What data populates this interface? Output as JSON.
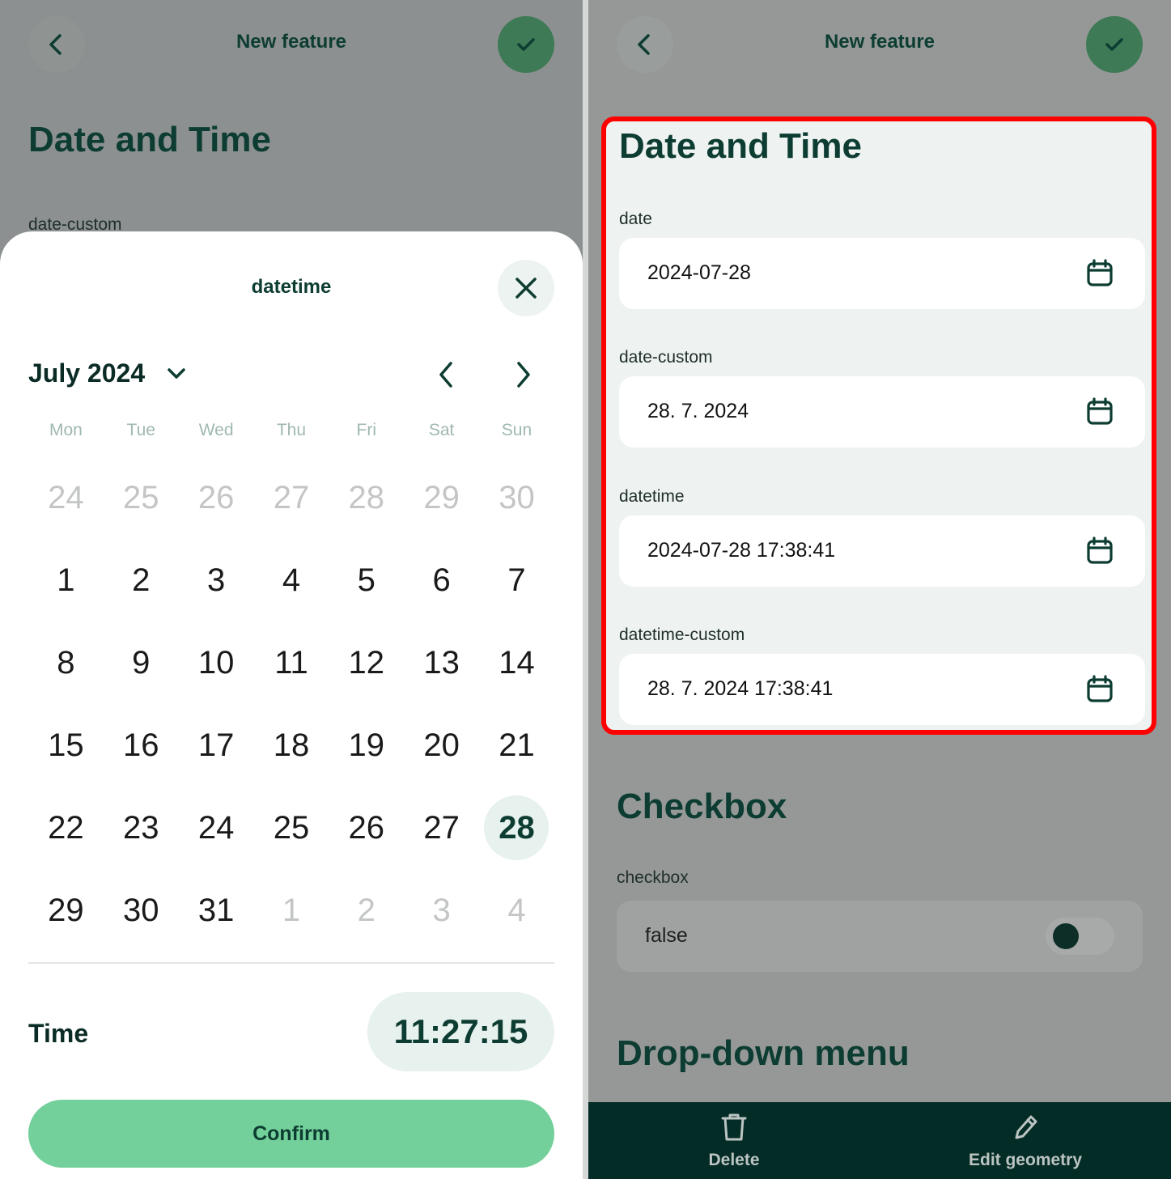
{
  "left_screen": {
    "topbar": {
      "title": "New feature"
    },
    "section_title": "Date and Time",
    "visible_field_label": "date-custom",
    "picker": {
      "title": "datetime",
      "month_label": "July 2024",
      "weekdays": [
        "Mon",
        "Tue",
        "Wed",
        "Thu",
        "Fri",
        "Sat",
        "Sun"
      ],
      "days": [
        {
          "d": "24",
          "muted": true
        },
        {
          "d": "25",
          "muted": true
        },
        {
          "d": "26",
          "muted": true
        },
        {
          "d": "27",
          "muted": true
        },
        {
          "d": "28",
          "muted": true
        },
        {
          "d": "29",
          "muted": true
        },
        {
          "d": "30",
          "muted": true
        },
        {
          "d": "1"
        },
        {
          "d": "2"
        },
        {
          "d": "3"
        },
        {
          "d": "4"
        },
        {
          "d": "5"
        },
        {
          "d": "6"
        },
        {
          "d": "7"
        },
        {
          "d": "8"
        },
        {
          "d": "9"
        },
        {
          "d": "10"
        },
        {
          "d": "11"
        },
        {
          "d": "12"
        },
        {
          "d": "13"
        },
        {
          "d": "14"
        },
        {
          "d": "15"
        },
        {
          "d": "16"
        },
        {
          "d": "17"
        },
        {
          "d": "18"
        },
        {
          "d": "19"
        },
        {
          "d": "20"
        },
        {
          "d": "21"
        },
        {
          "d": "22"
        },
        {
          "d": "23"
        },
        {
          "d": "24"
        },
        {
          "d": "25"
        },
        {
          "d": "26"
        },
        {
          "d": "27"
        },
        {
          "d": "28",
          "selected": true
        },
        {
          "d": "29"
        },
        {
          "d": "30"
        },
        {
          "d": "31"
        },
        {
          "d": "1",
          "muted": true
        },
        {
          "d": "2",
          "muted": true
        },
        {
          "d": "3",
          "muted": true
        },
        {
          "d": "4",
          "muted": true
        }
      ],
      "time_label": "Time",
      "time_value": "11:27:15",
      "confirm_label": "Confirm"
    }
  },
  "right_screen": {
    "topbar": {
      "title": "New feature"
    },
    "date_time_section": {
      "title": "Date and Time",
      "fields": [
        {
          "label": "date",
          "value": "2024-07-28"
        },
        {
          "label": "date-custom",
          "value": "28. 7. 2024"
        },
        {
          "label": "datetime",
          "value": "2024-07-28 17:38:41"
        },
        {
          "label": "datetime-custom",
          "value": "28. 7. 2024 17:38:41"
        }
      ]
    },
    "checkbox_section": {
      "title": "Checkbox",
      "label": "checkbox",
      "value": "false",
      "checked": false
    },
    "dropdown_section": {
      "title": "Drop-down menu"
    },
    "bottom_bar": {
      "delete_label": "Delete",
      "edit_geometry_label": "Edit geometry"
    }
  },
  "colors": {
    "accent_dark": "#0d3d32",
    "confirm_green": "#73d09a",
    "ok_button": "#3d7a55",
    "highlight_border": "#ff0000",
    "bottom_bar": "#032c26"
  }
}
